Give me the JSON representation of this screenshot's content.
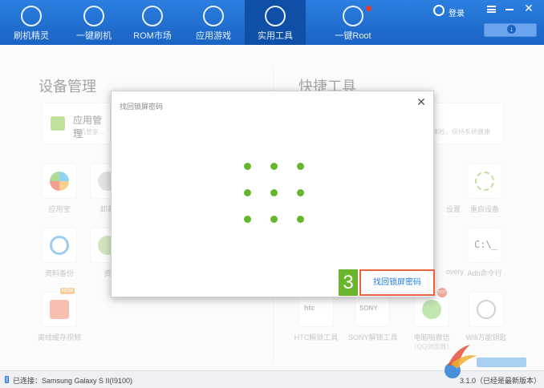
{
  "nav": {
    "tabs": [
      {
        "label": "刷机精灵",
        "icon": "shield-icon"
      },
      {
        "label": "一键刷机",
        "icon": "cursor-icon"
      },
      {
        "label": "ROM市场",
        "icon": "rom-icon"
      },
      {
        "label": "应用游戏",
        "icon": "mail-icon"
      },
      {
        "label": "实用工具",
        "icon": "grid-icon",
        "active": true
      },
      {
        "label": "一键Root",
        "icon": "root-icon",
        "has_notification": true
      }
    ],
    "login_label": "登录"
  },
  "left_section": {
    "title": "设备管理",
    "app_card": {
      "title": "应用管理",
      "subtitle": "手机管家..."
    },
    "tools": [
      {
        "label": "应用宝"
      },
      {
        "label": "卸载"
      },
      {
        "label": "资料备份"
      },
      {
        "label": "资"
      },
      {
        "label": "离线缓存视频",
        "badge": "NEW"
      }
    ]
  },
  "right_section": {
    "title": "快捷工具",
    "card_subtitle": "体检，保持系统健康",
    "tools": [
      {
        "label": "设置"
      },
      {
        "label": "重启设备"
      },
      {
        "label": "overy"
      },
      {
        "label": "Adb命令行"
      },
      {
        "label": "HTC解锁工具"
      },
      {
        "label": "SONY解锁工具"
      },
      {
        "label": "电脑啪微信",
        "sublabel": "（QQ浏览器）",
        "badge": "HOT"
      },
      {
        "label": "Wifi万能钥匙"
      }
    ]
  },
  "modal": {
    "title": "找回锁屏密码",
    "step_number": "3",
    "find_button_label": "找回锁屏密码",
    "pattern": "3x3 grid"
  },
  "status": {
    "connection": "已连接：Samsung Galaxy S II(I9100)",
    "version": "3.1.0（已经是最新版本）"
  },
  "colors": {
    "accent": "#1f6fd0",
    "pattern_dot": "#66b52e",
    "highlight_border": "#e9643c"
  }
}
